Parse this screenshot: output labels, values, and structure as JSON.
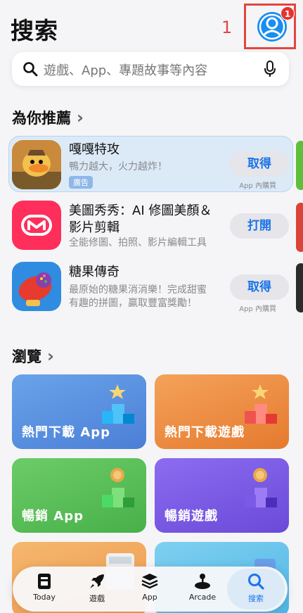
{
  "header": {
    "title": "搜索",
    "annotation_number": "1",
    "profile_badge_count": "1"
  },
  "search": {
    "placeholder": "遊戲、App、專題故事等內容"
  },
  "recommended": {
    "title": "為你推薦",
    "apps": [
      {
        "name": "嘎嘎特攻",
        "subtitle": "鴨力越大，火力越炸！",
        "badge": "廣告",
        "button": "取得",
        "note": "App 內購買"
      },
      {
        "name_line1": "美圖秀秀：AI 修圖美顏＆",
        "name_line2": "影片剪輯",
        "subtitle": "全能修圖、拍照、影片編輯工具",
        "button": "打開"
      },
      {
        "name": "糖果傳奇",
        "subtitle_line1": "最原始的糖果消消樂！完成甜蜜",
        "subtitle_line2": "有趣的拼圖，贏取豐富獎勵！",
        "button": "取得",
        "note": "App 內購買"
      }
    ]
  },
  "browse": {
    "title": "瀏覽",
    "tiles": [
      {
        "label": "熱門下載 App",
        "color": "#5b8fe0"
      },
      {
        "label": "熱門下載遊戲",
        "color": "#ee8a3f"
      },
      {
        "label": "暢銷 App",
        "color": "#5cc05a"
      },
      {
        "label": "暢銷遊戲",
        "color": "#7b5ee0"
      }
    ]
  },
  "tabbar": {
    "items": [
      {
        "label": "Today",
        "icon": "today-icon"
      },
      {
        "label": "遊戲",
        "icon": "rocket-icon"
      },
      {
        "label": "App",
        "icon": "stack-icon"
      },
      {
        "label": "Arcade",
        "icon": "joystick-icon"
      },
      {
        "label": "搜索",
        "icon": "search-icon",
        "active": true
      }
    ]
  },
  "colors": {
    "accent": "#1a73e8",
    "annotation": "#e2473f",
    "badge": "#e8322b"
  }
}
